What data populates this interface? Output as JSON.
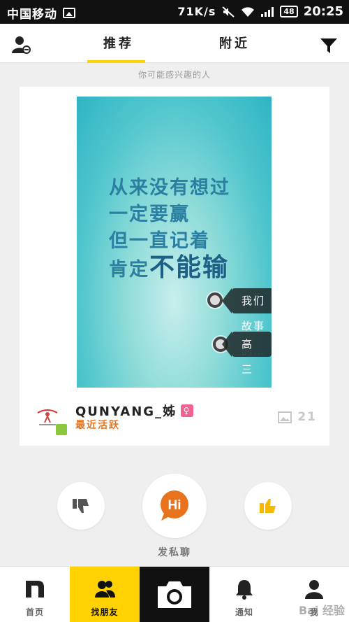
{
  "status_bar": {
    "carrier": "中国移动",
    "network_speed": "71K/s",
    "battery": "48",
    "time": "20:25"
  },
  "top_nav": {
    "tabs": [
      {
        "label": "推荐",
        "active": true
      },
      {
        "label": "附近",
        "active": false
      }
    ]
  },
  "hint_text": "你可能感兴趣的人",
  "card": {
    "photo": {
      "quote_lines": [
        "从来没有想过",
        "一定要赢",
        "但一直记着",
        "肯定"
      ],
      "quote_emphasis": "不能输",
      "tags": [
        "我们故事的…",
        "高三党"
      ]
    },
    "username": "QUNYANG_姊",
    "status": "最近活跃",
    "photo_count": "21"
  },
  "actions": {
    "chat_hi": "Hi",
    "chat_label": "发私聊"
  },
  "bottom_nav": {
    "items": [
      "首页",
      "找朋友",
      "",
      "通知",
      "我"
    ]
  },
  "watermark": "Bai 经验",
  "colors": {
    "accent": "#ffd200",
    "chat_orange": "#e8731c",
    "like_yellow": "#f5b800",
    "active_orange": "#e8731c"
  }
}
